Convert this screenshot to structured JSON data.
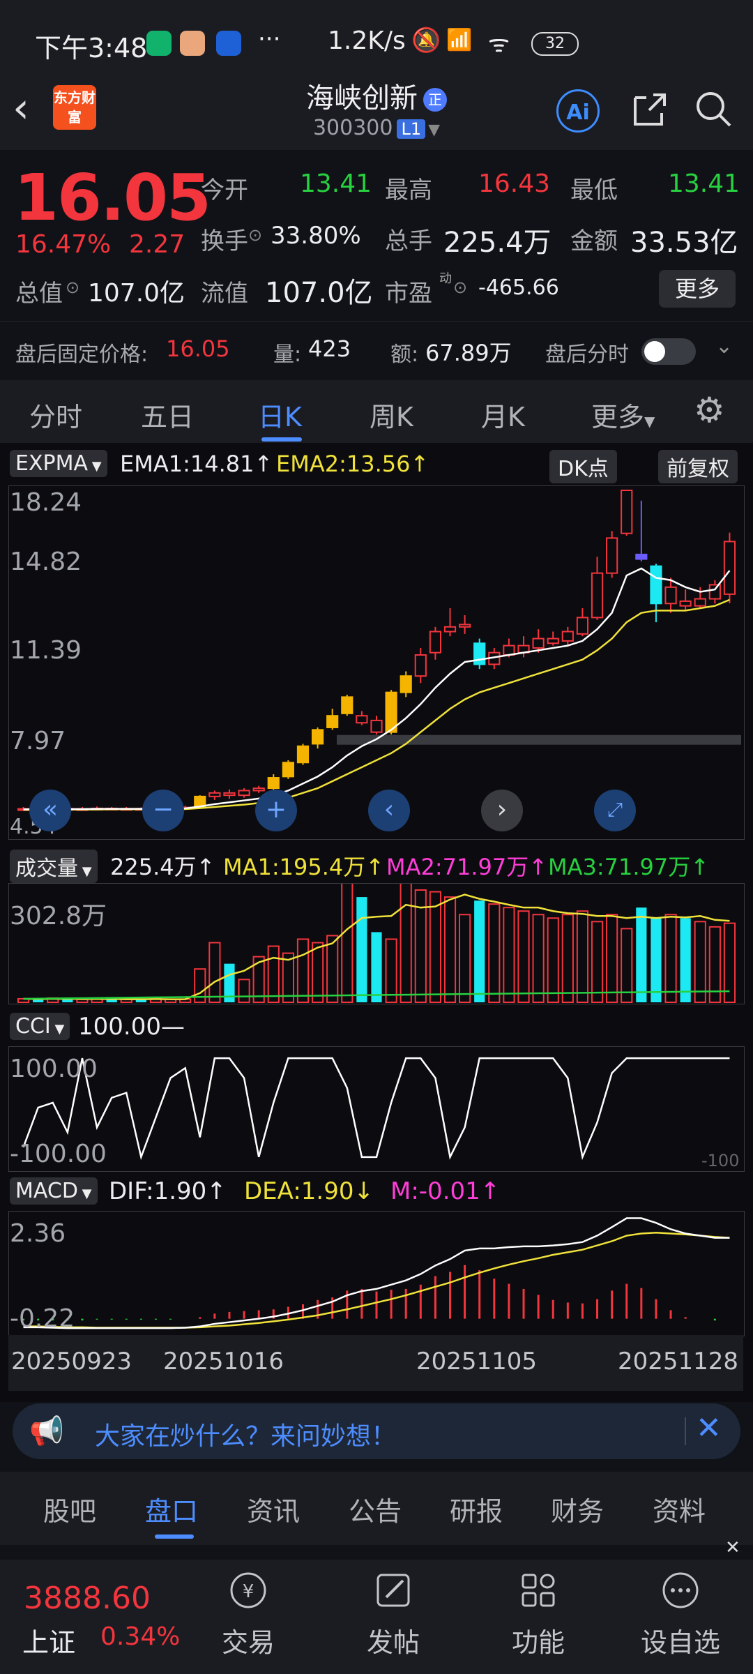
{
  "status_bar": {
    "time": "下午3:48",
    "speed": "1.2K/s",
    "battery": "32",
    "dots": "···"
  },
  "header": {
    "back_icon": "chevron-left-icon",
    "brand_logo": "东方财富",
    "stock_name": "海峡创新",
    "badge": "正",
    "stock_code": "300300",
    "level_badge": "L1",
    "ai_label": "Ai"
  },
  "quote": {
    "price": "16.05",
    "change_pct": "16.47%",
    "change_amt": "2.27",
    "open_label": "今开",
    "open": "13.41",
    "high_label": "最高",
    "high": "16.43",
    "low_label": "最低",
    "low": "13.41",
    "turnover_label": "换手",
    "turnover": "33.80%",
    "volume_label": "总手",
    "volume": "225.4万",
    "amount_label": "金额",
    "amount": "33.53亿",
    "mktcap_label": "总值",
    "mktcap": "107.0亿",
    "float_label": "流值",
    "float": "107.0亿",
    "pe_label": "市盈",
    "pe_sup": "动",
    "pe": "-465.66",
    "more_label": "更多",
    "after_price_label": "盘后固定价格:",
    "after_price": "16.05",
    "after_qty_label": "量:",
    "after_qty": "423",
    "after_amt_label": "额:",
    "after_amt": "67.89万",
    "after_time_label": "盘后分时"
  },
  "ktabs": {
    "items": [
      "分时",
      "五日",
      "日K",
      "周K",
      "月K",
      "更多"
    ],
    "active": "日K"
  },
  "main_chart": {
    "indicator": "EXPMA",
    "ema1_label": "EMA1:14.81↑",
    "ema2_label": "EMA2:13.56↑",
    "dk_label": "DK点",
    "fq_label": "前复权",
    "y_ticks": [
      "18.24",
      "14.82",
      "11.39",
      "7.97",
      "4.54"
    ]
  },
  "volume_chart": {
    "indicator": "成交量",
    "vol_label": "225.4万↑",
    "ma1_label": "MA1:195.4万↑",
    "ma2_label": "MA2:71.97万↑",
    "ma3_label": "MA3:71.97万↑",
    "y_tick": "302.8万"
  },
  "cci_chart": {
    "indicator": "CCI",
    "value_label": "100.00—",
    "y_top": "100.00",
    "y_bottom": "-100.00",
    "y_right": "-100"
  },
  "macd_chart": {
    "indicator": "MACD",
    "dif_label": "DIF:1.90↑",
    "dea_label": "DEA:1.90↓",
    "m_label": "M:-0.01↑",
    "y_top": "2.36",
    "y_bottom": "-0.22"
  },
  "dates": [
    "20250923",
    "20251016",
    "20251105",
    "20251128"
  ],
  "chart_data": {
    "type": "candlestick",
    "y_range": [
      4.54,
      18.24
    ],
    "candles": [
      {
        "o": 4.6,
        "c": 4.62,
        "h": 4.7,
        "l": 4.55
      },
      {
        "o": 4.62,
        "c": 4.6,
        "h": 4.68,
        "l": 4.55
      },
      {
        "o": 4.6,
        "c": 4.63,
        "h": 4.7,
        "l": 4.56
      },
      {
        "o": 4.63,
        "c": 4.62,
        "h": 4.68,
        "l": 4.57
      },
      {
        "o": 4.62,
        "c": 4.62,
        "h": 4.7,
        "l": 4.58
      },
      {
        "o": 4.62,
        "c": 4.64,
        "h": 4.72,
        "l": 4.58
      },
      {
        "o": 4.64,
        "c": 4.62,
        "h": 4.7,
        "l": 4.58
      },
      {
        "o": 4.62,
        "c": 4.63,
        "h": 4.7,
        "l": 4.58
      },
      {
        "o": 4.63,
        "c": 4.62,
        "h": 4.68,
        "l": 4.58
      },
      {
        "o": 4.62,
        "c": 4.65,
        "h": 4.7,
        "l": 4.6
      },
      {
        "o": 4.65,
        "c": 4.65,
        "h": 4.7,
        "l": 4.6
      },
      {
        "o": 4.65,
        "c": 4.68,
        "h": 4.75,
        "l": 4.6
      },
      {
        "o": 4.68,
        "c": 5.15,
        "h": 5.2,
        "l": 4.65
      },
      {
        "o": 5.15,
        "c": 5.3,
        "h": 5.4,
        "l": 5.0
      },
      {
        "o": 5.3,
        "c": 5.2,
        "h": 5.45,
        "l": 5.05
      },
      {
        "o": 5.2,
        "c": 5.4,
        "h": 5.5,
        "l": 5.1
      },
      {
        "o": 5.4,
        "c": 5.5,
        "h": 5.6,
        "l": 5.3
      },
      {
        "o": 5.5,
        "c": 5.95,
        "h": 6.1,
        "l": 5.4
      },
      {
        "o": 6.0,
        "c": 6.6,
        "h": 6.7,
        "l": 5.9
      },
      {
        "o": 6.6,
        "c": 7.3,
        "h": 7.4,
        "l": 6.5
      },
      {
        "o": 7.4,
        "c": 8.0,
        "h": 8.1,
        "l": 7.2
      },
      {
        "o": 8.1,
        "c": 8.6,
        "h": 8.9,
        "l": 8.0
      },
      {
        "o": 8.7,
        "c": 9.4,
        "h": 9.5,
        "l": 8.6
      },
      {
        "o": 8.6,
        "c": 8.3,
        "h": 8.8,
        "l": 8.2
      },
      {
        "o": 8.4,
        "c": 7.9,
        "h": 8.6,
        "l": 7.8
      },
      {
        "o": 7.9,
        "c": 9.6,
        "h": 9.7,
        "l": 7.8
      },
      {
        "o": 9.6,
        "c": 10.3,
        "h": 10.5,
        "l": 9.4
      },
      {
        "o": 10.3,
        "c": 11.2,
        "h": 11.5,
        "l": 10.0
      },
      {
        "o": 11.3,
        "c": 12.2,
        "h": 12.4,
        "l": 11.0
      },
      {
        "o": 12.2,
        "c": 12.4,
        "h": 13.2,
        "l": 12.0
      },
      {
        "o": 12.4,
        "c": 12.5,
        "h": 12.9,
        "l": 12.1
      },
      {
        "o": 11.7,
        "c": 10.8,
        "h": 11.9,
        "l": 10.6
      },
      {
        "o": 10.8,
        "c": 11.3,
        "h": 11.5,
        "l": 10.6
      },
      {
        "o": 11.2,
        "c": 11.6,
        "h": 11.9,
        "l": 11.1
      },
      {
        "o": 11.3,
        "c": 11.6,
        "h": 12.0,
        "l": 11.1
      },
      {
        "o": 11.5,
        "c": 11.9,
        "h": 12.3,
        "l": 11.3
      },
      {
        "o": 11.7,
        "c": 11.9,
        "h": 12.2,
        "l": 11.6
      },
      {
        "o": 11.8,
        "c": 12.2,
        "h": 12.4,
        "l": 11.6
      },
      {
        "o": 12.1,
        "c": 12.8,
        "h": 13.2,
        "l": 12.0
      },
      {
        "o": 12.8,
        "c": 14.7,
        "h": 15.4,
        "l": 12.7
      },
      {
        "o": 14.7,
        "c": 16.2,
        "h": 16.5,
        "l": 14.5
      },
      {
        "o": 16.4,
        "c": 18.24,
        "h": 18.24,
        "l": 16.3
      },
      {
        "o": 15.5,
        "c": 15.3,
        "h": 17.8,
        "l": 15.2
      },
      {
        "o": 15.0,
        "c": 13.4,
        "h": 15.1,
        "l": 12.6
      },
      {
        "o": 13.4,
        "c": 14.1,
        "h": 14.5,
        "l": 13.0
      },
      {
        "o": 13.5,
        "c": 13.3,
        "h": 14.0,
        "l": 13.1
      },
      {
        "o": 13.3,
        "c": 13.6,
        "h": 14.1,
        "l": 13.2
      },
      {
        "o": 13.6,
        "c": 14.2,
        "h": 14.4,
        "l": 13.4
      },
      {
        "o": 13.8,
        "c": 16.05,
        "h": 16.43,
        "l": 13.41
      }
    ],
    "ema1": [
      4.6,
      4.6,
      4.61,
      4.61,
      4.61,
      4.62,
      4.62,
      4.62,
      4.62,
      4.63,
      4.63,
      4.64,
      4.72,
      4.82,
      4.9,
      4.98,
      5.06,
      5.2,
      5.4,
      5.7,
      6.0,
      6.4,
      6.9,
      7.3,
      7.6,
      8.0,
      8.5,
      9.1,
      9.8,
      10.4,
      10.9,
      11.0,
      11.1,
      11.2,
      11.3,
      11.4,
      11.5,
      11.6,
      11.8,
      12.3,
      13.0,
      14.6,
      14.9,
      14.5,
      14.4,
      14.1,
      13.9,
      14.0,
      14.81
    ],
    "ema2": [
      4.58,
      4.58,
      4.58,
      4.59,
      4.59,
      4.59,
      4.6,
      4.6,
      4.6,
      4.6,
      4.61,
      4.61,
      4.65,
      4.7,
      4.75,
      4.8,
      4.87,
      4.95,
      5.1,
      5.3,
      5.5,
      5.8,
      6.1,
      6.4,
      6.7,
      7.0,
      7.4,
      7.9,
      8.4,
      8.9,
      9.3,
      9.6,
      9.8,
      10.0,
      10.2,
      10.4,
      10.6,
      10.8,
      11.0,
      11.4,
      11.9,
      12.6,
      13.0,
      13.1,
      13.1,
      13.1,
      13.2,
      13.3,
      13.56
    ],
    "volume_wan": [
      10,
      8,
      12,
      9,
      8,
      10,
      9,
      8,
      9,
      10,
      8,
      9,
      95,
      170,
      110,
      65,
      130,
      160,
      140,
      180,
      170,
      190,
      360,
      300,
      200,
      180,
      350,
      320,
      315,
      300,
      250,
      290,
      280,
      270,
      260,
      250,
      240,
      250,
      260,
      230,
      250,
      210,
      270,
      240,
      250,
      240,
      230,
      215,
      225.4
    ],
    "cci": [
      -80,
      0,
      10,
      -50,
      100,
      -40,
      20,
      30,
      -100,
      -20,
      60,
      80,
      -60,
      100,
      100,
      60,
      -100,
      10,
      100,
      100,
      100,
      100,
      40,
      -100,
      -100,
      10,
      100,
      100,
      60,
      -100,
      -40,
      100,
      100,
      100,
      100,
      100,
      100,
      60,
      -100,
      -30,
      70,
      100,
      100,
      100,
      100,
      100,
      100,
      100,
      100
    ],
    "macd_dif": [
      -0.2,
      -0.2,
      -0.21,
      -0.22,
      -0.22,
      -0.22,
      -0.22,
      -0.22,
      -0.22,
      -0.22,
      -0.22,
      -0.21,
      -0.18,
      -0.12,
      -0.08,
      -0.04,
      0.0,
      0.05,
      0.12,
      0.2,
      0.3,
      0.4,
      0.55,
      0.65,
      0.7,
      0.8,
      0.9,
      1.05,
      1.25,
      1.4,
      1.6,
      1.65,
      1.65,
      1.68,
      1.7,
      1.7,
      1.72,
      1.75,
      1.8,
      1.95,
      2.15,
      2.36,
      2.36,
      2.25,
      2.1,
      2.0,
      1.95,
      1.9,
      1.9
    ],
    "macd_dea": [
      -0.18,
      -0.18,
      -0.19,
      -0.2,
      -0.2,
      -0.21,
      -0.21,
      -0.21,
      -0.21,
      -0.21,
      -0.21,
      -0.21,
      -0.2,
      -0.18,
      -0.16,
      -0.13,
      -0.1,
      -0.06,
      -0.02,
      0.03,
      0.08,
      0.15,
      0.22,
      0.3,
      0.38,
      0.46,
      0.55,
      0.65,
      0.75,
      0.85,
      0.97,
      1.08,
      1.18,
      1.27,
      1.35,
      1.42,
      1.5,
      1.56,
      1.62,
      1.72,
      1.82,
      1.95,
      2.0,
      2.02,
      2.0,
      1.98,
      1.95,
      1.92,
      1.9
    ]
  },
  "ask_bar": {
    "text": "大家在炒什么？来问妙想！"
  },
  "bottom_tabs": {
    "items": [
      "股吧",
      "盘口",
      "资讯",
      "公告",
      "研报",
      "财务",
      "资料"
    ],
    "active": "盘口"
  },
  "bottom_bar": {
    "index_value": "3888.60",
    "index_name": "上证",
    "index_change": "0.34%",
    "actions": [
      {
        "label": "交易",
        "icon": "yen-trade-icon"
      },
      {
        "label": "发帖",
        "icon": "edit-post-icon"
      },
      {
        "label": "功能",
        "icon": "grid-icon"
      },
      {
        "label": "设自选",
        "icon": "more-circle-icon"
      }
    ]
  },
  "colors": {
    "up": "#f3353d",
    "down_green": "#27d13f",
    "accent_blue": "#4d8dff",
    "candle_yellow": "#f4b400",
    "candle_cyan": "#1de9f2",
    "ema_white": "#ffffff",
    "ema_yellow": "#f0e23a"
  }
}
